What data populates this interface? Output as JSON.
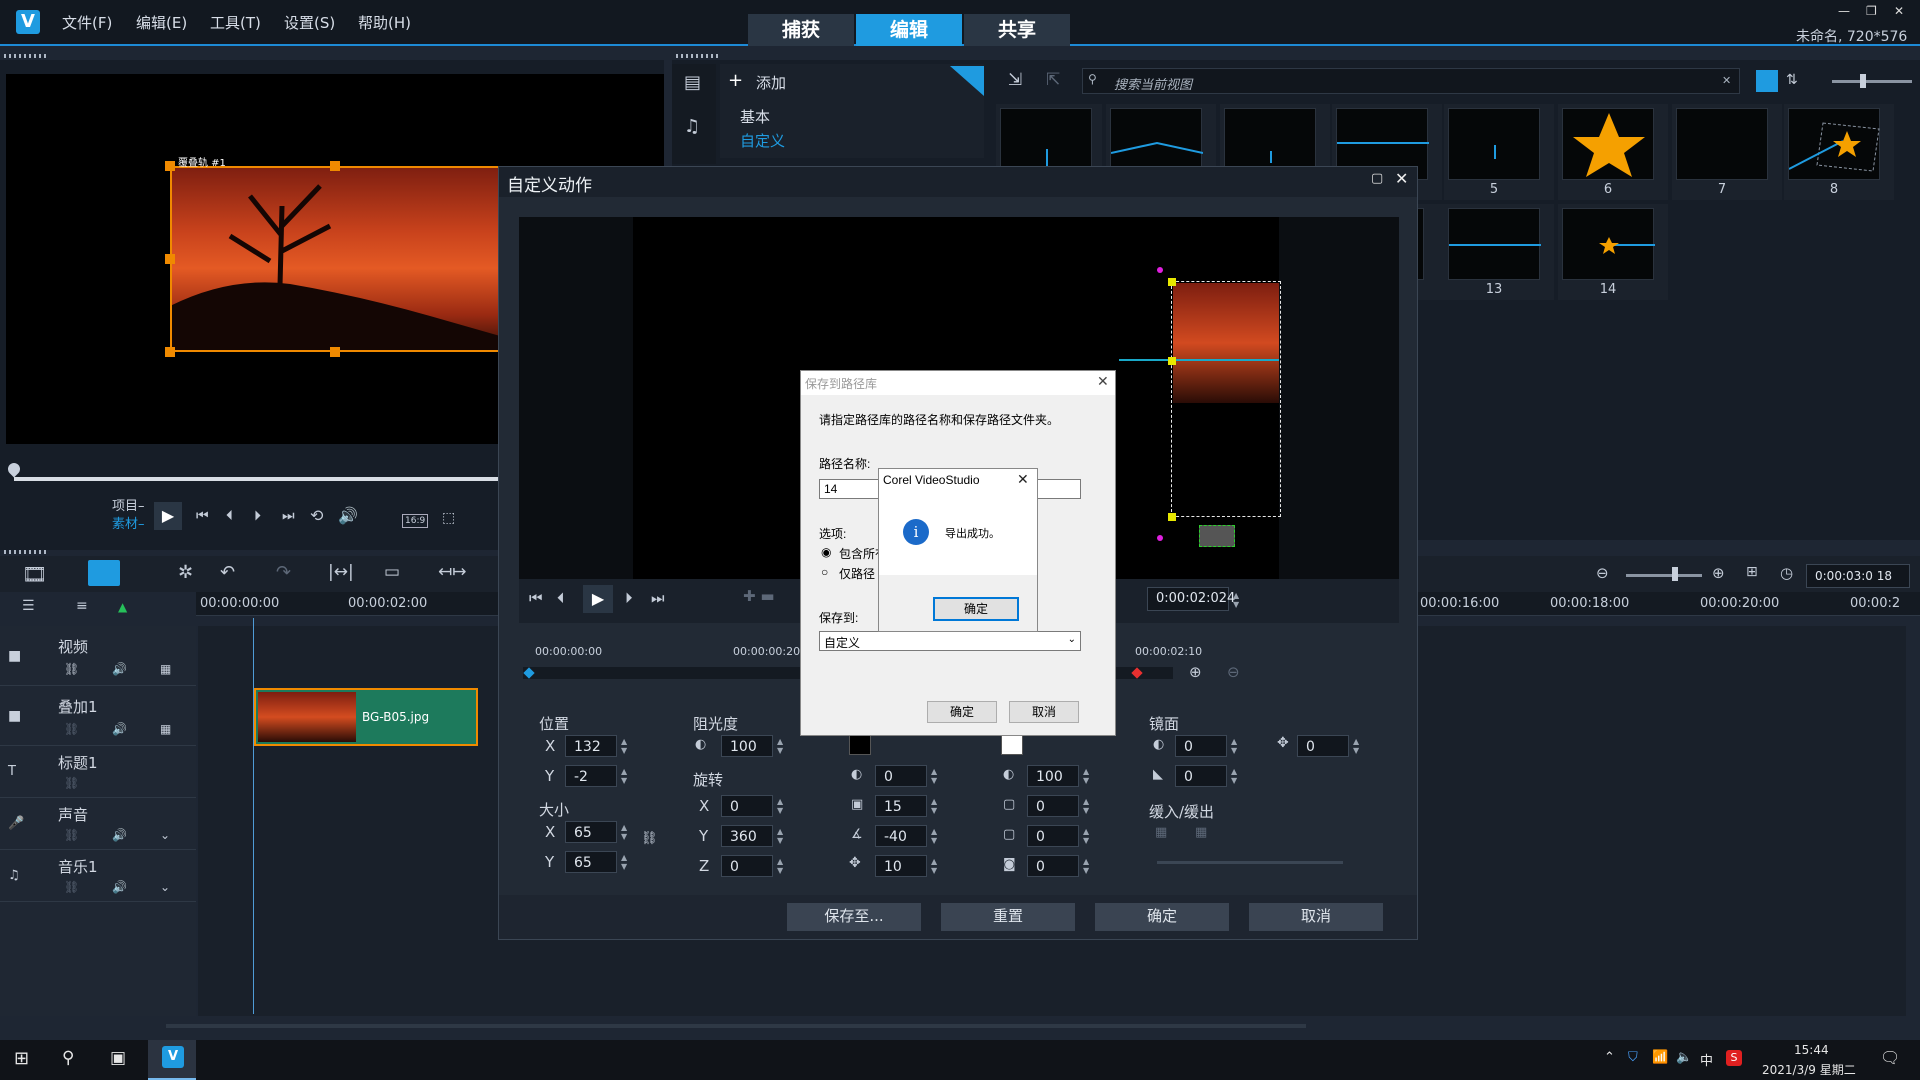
{
  "menu": {
    "file": "文件(F)",
    "edit": "编辑(E)",
    "tools": "工具(T)",
    "settings": "设置(S)",
    "help": "帮助(H)"
  },
  "mode_tabs": [
    "捕获",
    "编辑",
    "共享"
  ],
  "project_info": "未命名, 720*576",
  "preview": {
    "overlay_label": "覆叠轨 #1",
    "project_label": "项目–",
    "clip_label": "素材–",
    "aspect": "16:9"
  },
  "library": {
    "add_label": "添加",
    "categories": [
      "基本",
      "自定义"
    ],
    "search_placeholder": "搜索当前视图",
    "thumbnails_row1": [
      "",
      "",
      "",
      "",
      "5",
      "6",
      "7",
      "8"
    ],
    "thumbnails_row2": [
      "",
      "13",
      "14"
    ]
  },
  "timeline": {
    "timecode_start": "00:00:00:00",
    "timecode_2": "00:00:02:00",
    "ruler_right": [
      "00:00:16:00",
      "00:00:18:00",
      "00:00:20:00",
      "00:00:2"
    ],
    "zoom_time": "0:00:03:0 18",
    "tracks": [
      "视频",
      "叠加1",
      "标题1",
      "声音",
      "音乐1"
    ],
    "clip_name": "BG-B05.jpg"
  },
  "custom_motion": {
    "title": "自定义动作",
    "timecode": "0:00:02:024",
    "ruler": [
      "00:00:00:00",
      "00:00:00:20",
      "00:00:02:10"
    ],
    "position_label": "位置",
    "position_x": "132",
    "position_y": "-2",
    "size_label": "大小",
    "size_x": "65",
    "size_y": "65",
    "opacity_label": "阻光度",
    "opacity": "100",
    "rotate_label": "旋转",
    "rotate_x": "0",
    "rotate_y": "360",
    "rotate_z": "0",
    "border_values": [
      "0",
      "15",
      "-40",
      "10"
    ],
    "shadow_values": [
      "100",
      "0",
      "0",
      "0"
    ],
    "mirror_label": "镜面",
    "mirror_values": [
      "0",
      "0",
      "0"
    ],
    "ease_label": "缓入/缓出",
    "buttons": [
      "保存至...",
      "重置",
      "确定",
      "取消"
    ]
  },
  "save_path_dialog": {
    "title": "保存到路径库",
    "prompt": "请指定路径库的路径名称和保存路径文件夹。",
    "name_label": "路径名称:",
    "name_value": "14",
    "options_label": "选项:",
    "option1": "包含所有",
    "option2": "仅路径",
    "save_to_label": "保存到:",
    "save_to_value": "自定义",
    "ok": "确定",
    "cancel": "取消"
  },
  "message_box": {
    "title": "Corel VideoStudio",
    "message": "导出成功。",
    "ok": "确定"
  },
  "taskbar": {
    "time": "15:44",
    "date": "2021/3/9 星期二",
    "ime": "中"
  }
}
